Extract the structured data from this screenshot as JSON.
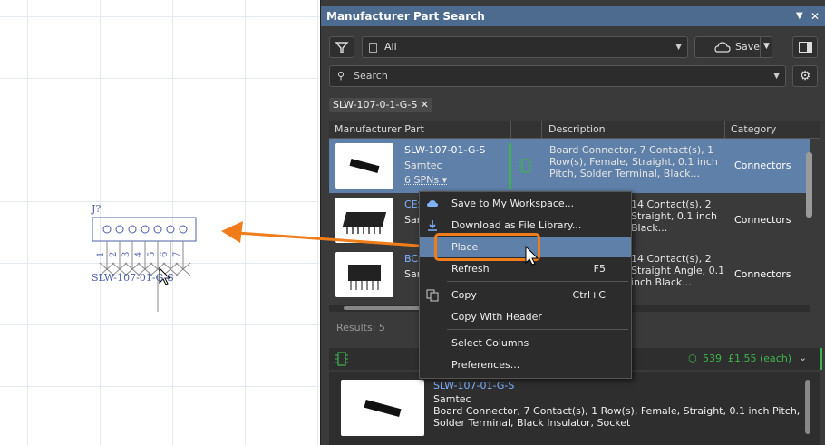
{
  "schematic": {
    "designator": "J?",
    "comment": "SLW-107-01-G-S",
    "pin_numbers": [
      "1",
      "2",
      "3",
      "4",
      "5",
      "6",
      "7"
    ]
  },
  "panel": {
    "title": "Manufacturer Part Search",
    "filter_dropdown": "All",
    "save_label": "Save",
    "search_placeholder": "Search",
    "active_filter_chip": "SLW-107-0-1-G-S",
    "columns": [
      "Manufacturer Part",
      "Description",
      "Category"
    ],
    "rows": [
      {
        "part": "SLW-107-01-G-S",
        "manufacturer": "Samtec",
        "spns": "6 SPNs",
        "description": "Board Connector, 7 Contact(s), 1 Row(s), Female, Straight, 0.1 inch Pitch, Solder Terminal, Black...",
        "category": "Connectors"
      },
      {
        "part": "CES",
        "manufacturer": "Sam",
        "description": "14 Contact(s), 2 Straight, 0.1 inch Black...",
        "category": "Connectors"
      },
      {
        "part": "BCS",
        "manufacturer": "Sam",
        "description": "14 Contact(s), 2 Straight Angle, 0.1 inch Black...",
        "category": "Connectors"
      }
    ],
    "results_label": "Results: 5",
    "detail": {
      "stock": "539",
      "price": "£1.55 (each)",
      "part": "SLW-107-01-G-S",
      "manufacturer": "Samtec",
      "description_line1": "Board Connector, 7 Contact(s), 1 Row(s), Female, Straight, 0.1 inch Pitch,",
      "description_line2": "Solder Terminal, Black Insulator, Socket"
    }
  },
  "context_menu": {
    "items": [
      {
        "label": "Save to My Workspace...",
        "shortcut": ""
      },
      {
        "label": "Download as File Library...",
        "shortcut": ""
      },
      {
        "label": "Place",
        "shortcut": ""
      },
      {
        "label": "Refresh",
        "shortcut": "F5"
      },
      {
        "label": "Copy",
        "shortcut": "Ctrl+C"
      },
      {
        "label": "Copy With Header",
        "shortcut": ""
      },
      {
        "label": "Select Columns",
        "shortcut": ""
      },
      {
        "label": "Preferences...",
        "shortcut": ""
      }
    ]
  },
  "colors": {
    "accent": "#5f80a8",
    "highlight_outline": "#f07d1a",
    "arrow": "#f07d1a",
    "status_green": "#3cb44b"
  }
}
